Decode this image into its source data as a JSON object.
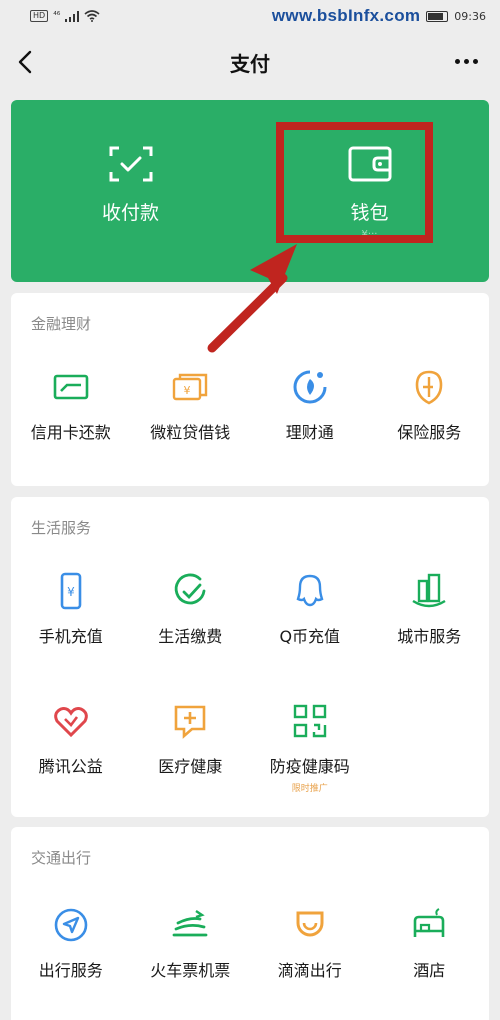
{
  "status_bar": {
    "network": "HD",
    "signal": "⁴⁶",
    "watermark": "www.bsbInfx.com",
    "time": "09:36"
  },
  "nav": {
    "title": "支付"
  },
  "top_card": {
    "items": [
      {
        "label": "收付款",
        "sub": ""
      },
      {
        "label": "钱包",
        "sub": "¥···"
      }
    ]
  },
  "sections": [
    {
      "title": "金融理财",
      "items": [
        {
          "label": "信用卡还款",
          "icon": "credit-card-icon"
        },
        {
          "label": "微粒贷借钱",
          "icon": "loan-icon"
        },
        {
          "label": "理财通",
          "icon": "wealth-icon"
        },
        {
          "label": "保险服务",
          "icon": "insurance-icon"
        }
      ]
    },
    {
      "title": "生活服务",
      "items": [
        {
          "label": "手机充值",
          "icon": "phone-topup-icon"
        },
        {
          "label": "生活缴费",
          "icon": "utility-bill-icon"
        },
        {
          "label": "Q币充值",
          "icon": "qq-coin-icon"
        },
        {
          "label": "城市服务",
          "icon": "city-service-icon"
        },
        {
          "label": "腾讯公益",
          "icon": "charity-icon"
        },
        {
          "label": "医疗健康",
          "icon": "medical-icon"
        },
        {
          "label": "防疫健康码",
          "icon": "health-code-icon",
          "tag": "限时推广"
        }
      ]
    },
    {
      "title": "交通出行",
      "items": [
        {
          "label": "出行服务",
          "icon": "travel-icon"
        },
        {
          "label": "火车票机票",
          "icon": "train-ticket-icon"
        },
        {
          "label": "滴滴出行",
          "icon": "didi-icon"
        },
        {
          "label": "酒店",
          "icon": "hotel-icon"
        }
      ]
    }
  ],
  "colors": {
    "wechat_green": "#2aae67",
    "finance_green": "#1aad5a",
    "orange": "#f0a33c",
    "blue": "#3a8ee6",
    "red": "#e0474c",
    "annotation_red": "#c0251f"
  }
}
